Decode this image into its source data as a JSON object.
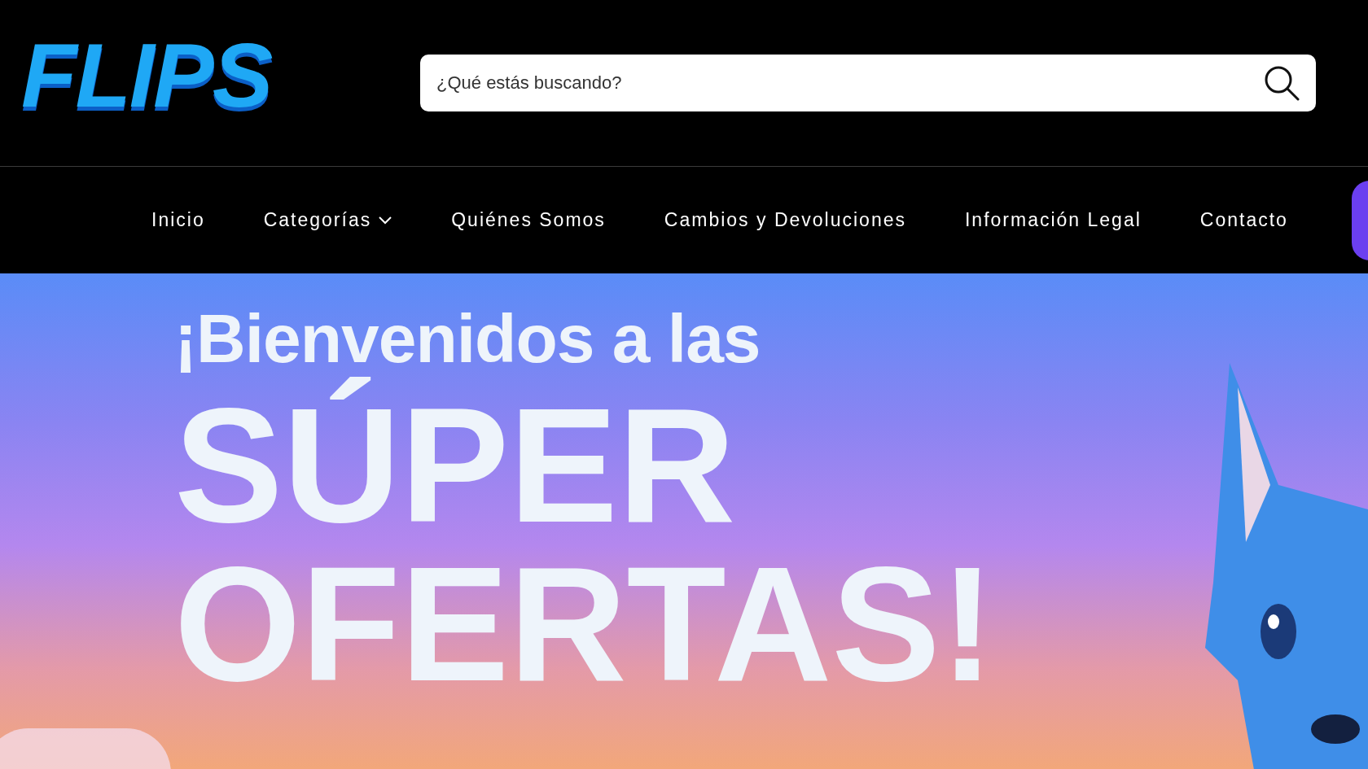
{
  "header": {
    "logo": "FLIPS",
    "search": {
      "placeholder": "¿Qué estás buscando?"
    }
  },
  "nav": [
    {
      "label": "Inicio",
      "dropdown": false
    },
    {
      "label": "Categorías",
      "dropdown": true
    },
    {
      "label": "Quiénes Somos",
      "dropdown": false
    },
    {
      "label": "Cambios y Devoluciones",
      "dropdown": false
    },
    {
      "label": "Información Legal",
      "dropdown": false
    },
    {
      "label": "Contacto",
      "dropdown": false
    }
  ],
  "hero": {
    "greeting": "¡Bienvenidos a las",
    "headline_1": "SÚPER",
    "headline_2": "OFERTAS!"
  }
}
